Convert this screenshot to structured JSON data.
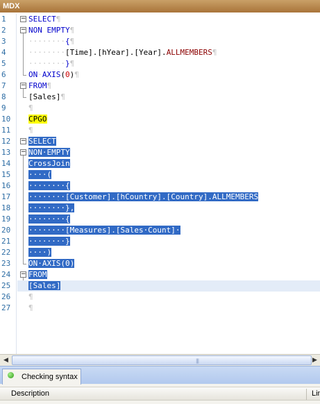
{
  "window": {
    "title": "MDX"
  },
  "editor": {
    "line_numbers": [
      "1",
      "2",
      "3",
      "4",
      "5",
      "6",
      "7",
      "8",
      "9",
      "10",
      "11",
      "12",
      "13",
      "14",
      "15",
      "16",
      "17",
      "18",
      "19",
      "20",
      "21",
      "22",
      "23",
      "24",
      "25",
      "26",
      "27"
    ],
    "lines": [
      {
        "segments": [
          {
            "t": "SELECT",
            "c": "kw"
          },
          {
            "t": "¶",
            "c": "dim"
          }
        ]
      },
      {
        "segments": [
          {
            "t": "NON",
            "c": "kw"
          },
          {
            "t": " ",
            "c": ""
          },
          {
            "t": "EMPTY",
            "c": "kw"
          },
          {
            "t": "¶",
            "c": "dim"
          }
        ]
      },
      {
        "segments": [
          {
            "t": "········",
            "c": "dim"
          },
          {
            "t": "{",
            "c": "br"
          },
          {
            "t": "¶",
            "c": "dim"
          }
        ]
      },
      {
        "segments": [
          {
            "t": "········",
            "c": "dim"
          },
          {
            "t": "[Time].[hYear].[Year].",
            "c": ""
          },
          {
            "t": "ALLMEMBERS",
            "c": "fn"
          },
          {
            "t": "¶",
            "c": "dim"
          }
        ]
      },
      {
        "segments": [
          {
            "t": "········",
            "c": "dim"
          },
          {
            "t": "}",
            "c": "br"
          },
          {
            "t": "¶",
            "c": "dim"
          }
        ]
      },
      {
        "segments": [
          {
            "t": "ON",
            "c": "kw"
          },
          {
            "t": "·",
            "c": "dim"
          },
          {
            "t": "AXIS",
            "c": "kw"
          },
          {
            "t": "(",
            "c": ""
          },
          {
            "t": "0",
            "c": "num"
          },
          {
            "t": ")",
            "c": ""
          },
          {
            "t": "¶",
            "c": "dim"
          }
        ]
      },
      {
        "segments": [
          {
            "t": "FROM",
            "c": "kw"
          },
          {
            "t": "¶",
            "c": "dim"
          }
        ]
      },
      {
        "segments": [
          {
            "t": "[Sales]",
            "c": ""
          },
          {
            "t": "¶",
            "c": "dim"
          }
        ]
      },
      {
        "segments": [
          {
            "t": "¶",
            "c": "dim"
          }
        ]
      },
      {
        "segments": [
          {
            "t": "CPGO",
            "c": "yellow"
          }
        ]
      },
      {
        "segments": [
          {
            "t": "¶",
            "c": "dim"
          }
        ]
      },
      {
        "segments": [
          {
            "t": "SELECT",
            "c": "sel"
          }
        ]
      },
      {
        "segments": [
          {
            "t": "NON·EMPTY",
            "c": "sel"
          }
        ]
      },
      {
        "segments": [
          {
            "t": "CrossJoin",
            "c": "sel"
          }
        ]
      },
      {
        "segments": [
          {
            "t": "····(",
            "c": "sel"
          }
        ]
      },
      {
        "segments": [
          {
            "t": "········{",
            "c": "sel"
          }
        ]
      },
      {
        "segments": [
          {
            "t": "········[Customer].[hCountry].[Country].ALLMEMBERS",
            "c": "sel"
          }
        ]
      },
      {
        "segments": [
          {
            "t": "········},",
            "c": "sel"
          }
        ]
      },
      {
        "segments": [
          {
            "t": "········{",
            "c": "sel"
          }
        ]
      },
      {
        "segments": [
          {
            "t": "········[Measures].[Sales·Count]·",
            "c": "sel"
          }
        ]
      },
      {
        "segments": [
          {
            "t": "········}",
            "c": "sel"
          }
        ]
      },
      {
        "segments": [
          {
            "t": "····)",
            "c": "sel"
          }
        ]
      },
      {
        "segments": [
          {
            "t": "ON·AXIS(0)",
            "c": "sel"
          }
        ]
      },
      {
        "segments": [
          {
            "t": "FROM",
            "c": "sel"
          }
        ]
      },
      {
        "segments": [
          {
            "t": "[Sales]",
            "c": "sel"
          }
        ]
      },
      {
        "segments": [
          {
            "t": "¶",
            "c": "dim"
          }
        ]
      },
      {
        "segments": [
          {
            "t": "¶",
            "c": "dim"
          }
        ]
      }
    ],
    "current_line": 25
  },
  "bottom_panel": {
    "tab_label": "Checking syntax",
    "columns": [
      "Description",
      "Lin"
    ]
  },
  "colors": {
    "keyword": "#0000cc",
    "function": "#8b0000",
    "number": "#cc0000",
    "selection": "#316ac5",
    "highlight": "#ffff00",
    "line_number": "#2f6ea5"
  }
}
